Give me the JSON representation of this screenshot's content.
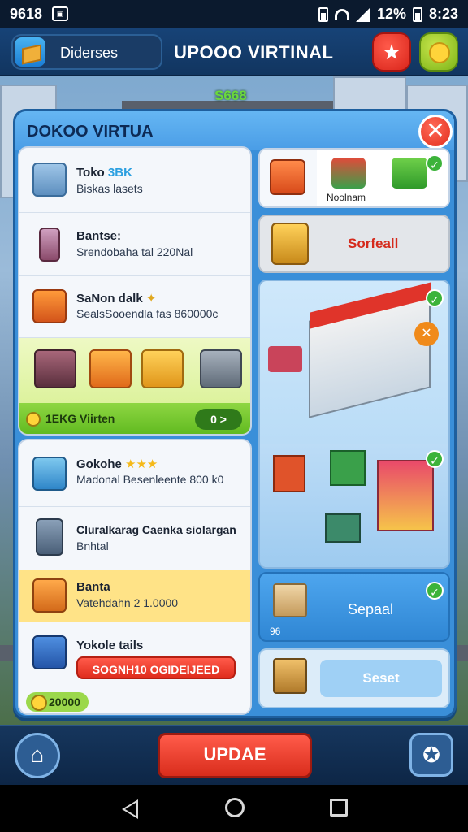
{
  "status_bar": {
    "time": "9618",
    "battery": "12%",
    "clock": "8:23"
  },
  "header": {
    "shop_name": "Diderses",
    "title": "UPOOO VIRTINAL"
  },
  "ticker": "S668",
  "panel": {
    "title": "DOKOO VIRTUA"
  },
  "list_a": [
    {
      "title": "Toko ",
      "accent": "3BK",
      "subtitle": "Biskas lasets"
    },
    {
      "title": "Bantse:",
      "subtitle": "Srendobaha tal 220Nal"
    },
    {
      "title": "SaNon dalk",
      "subtitle": "SealsSooendla fas 860000c"
    }
  ],
  "strip_bar": {
    "label": "1EKG Viirten",
    "action": "0 >"
  },
  "list_b": [
    {
      "title": "Gokohe",
      "stars": "★★★",
      "subtitle": "Madonal Besenleente 800 k0"
    },
    {
      "title": "Cluralkarag Caenka siolargan",
      "subtitle": "Bnhtal"
    },
    {
      "title": "Banta",
      "subtitle": "Vatehdahn 2 1.0000"
    },
    {
      "title": "Yokole tails",
      "cta": "SOGNH10 OGIDEIJEED"
    }
  ],
  "coins_total": "20000",
  "right_col": {
    "card1_label": "Noolnam",
    "card2_label": "Sorfeall",
    "card4_label": "Sepaal",
    "card4_small": "96",
    "card5_button": "Seset"
  },
  "bottom": {
    "update_label": "UPDAE"
  }
}
